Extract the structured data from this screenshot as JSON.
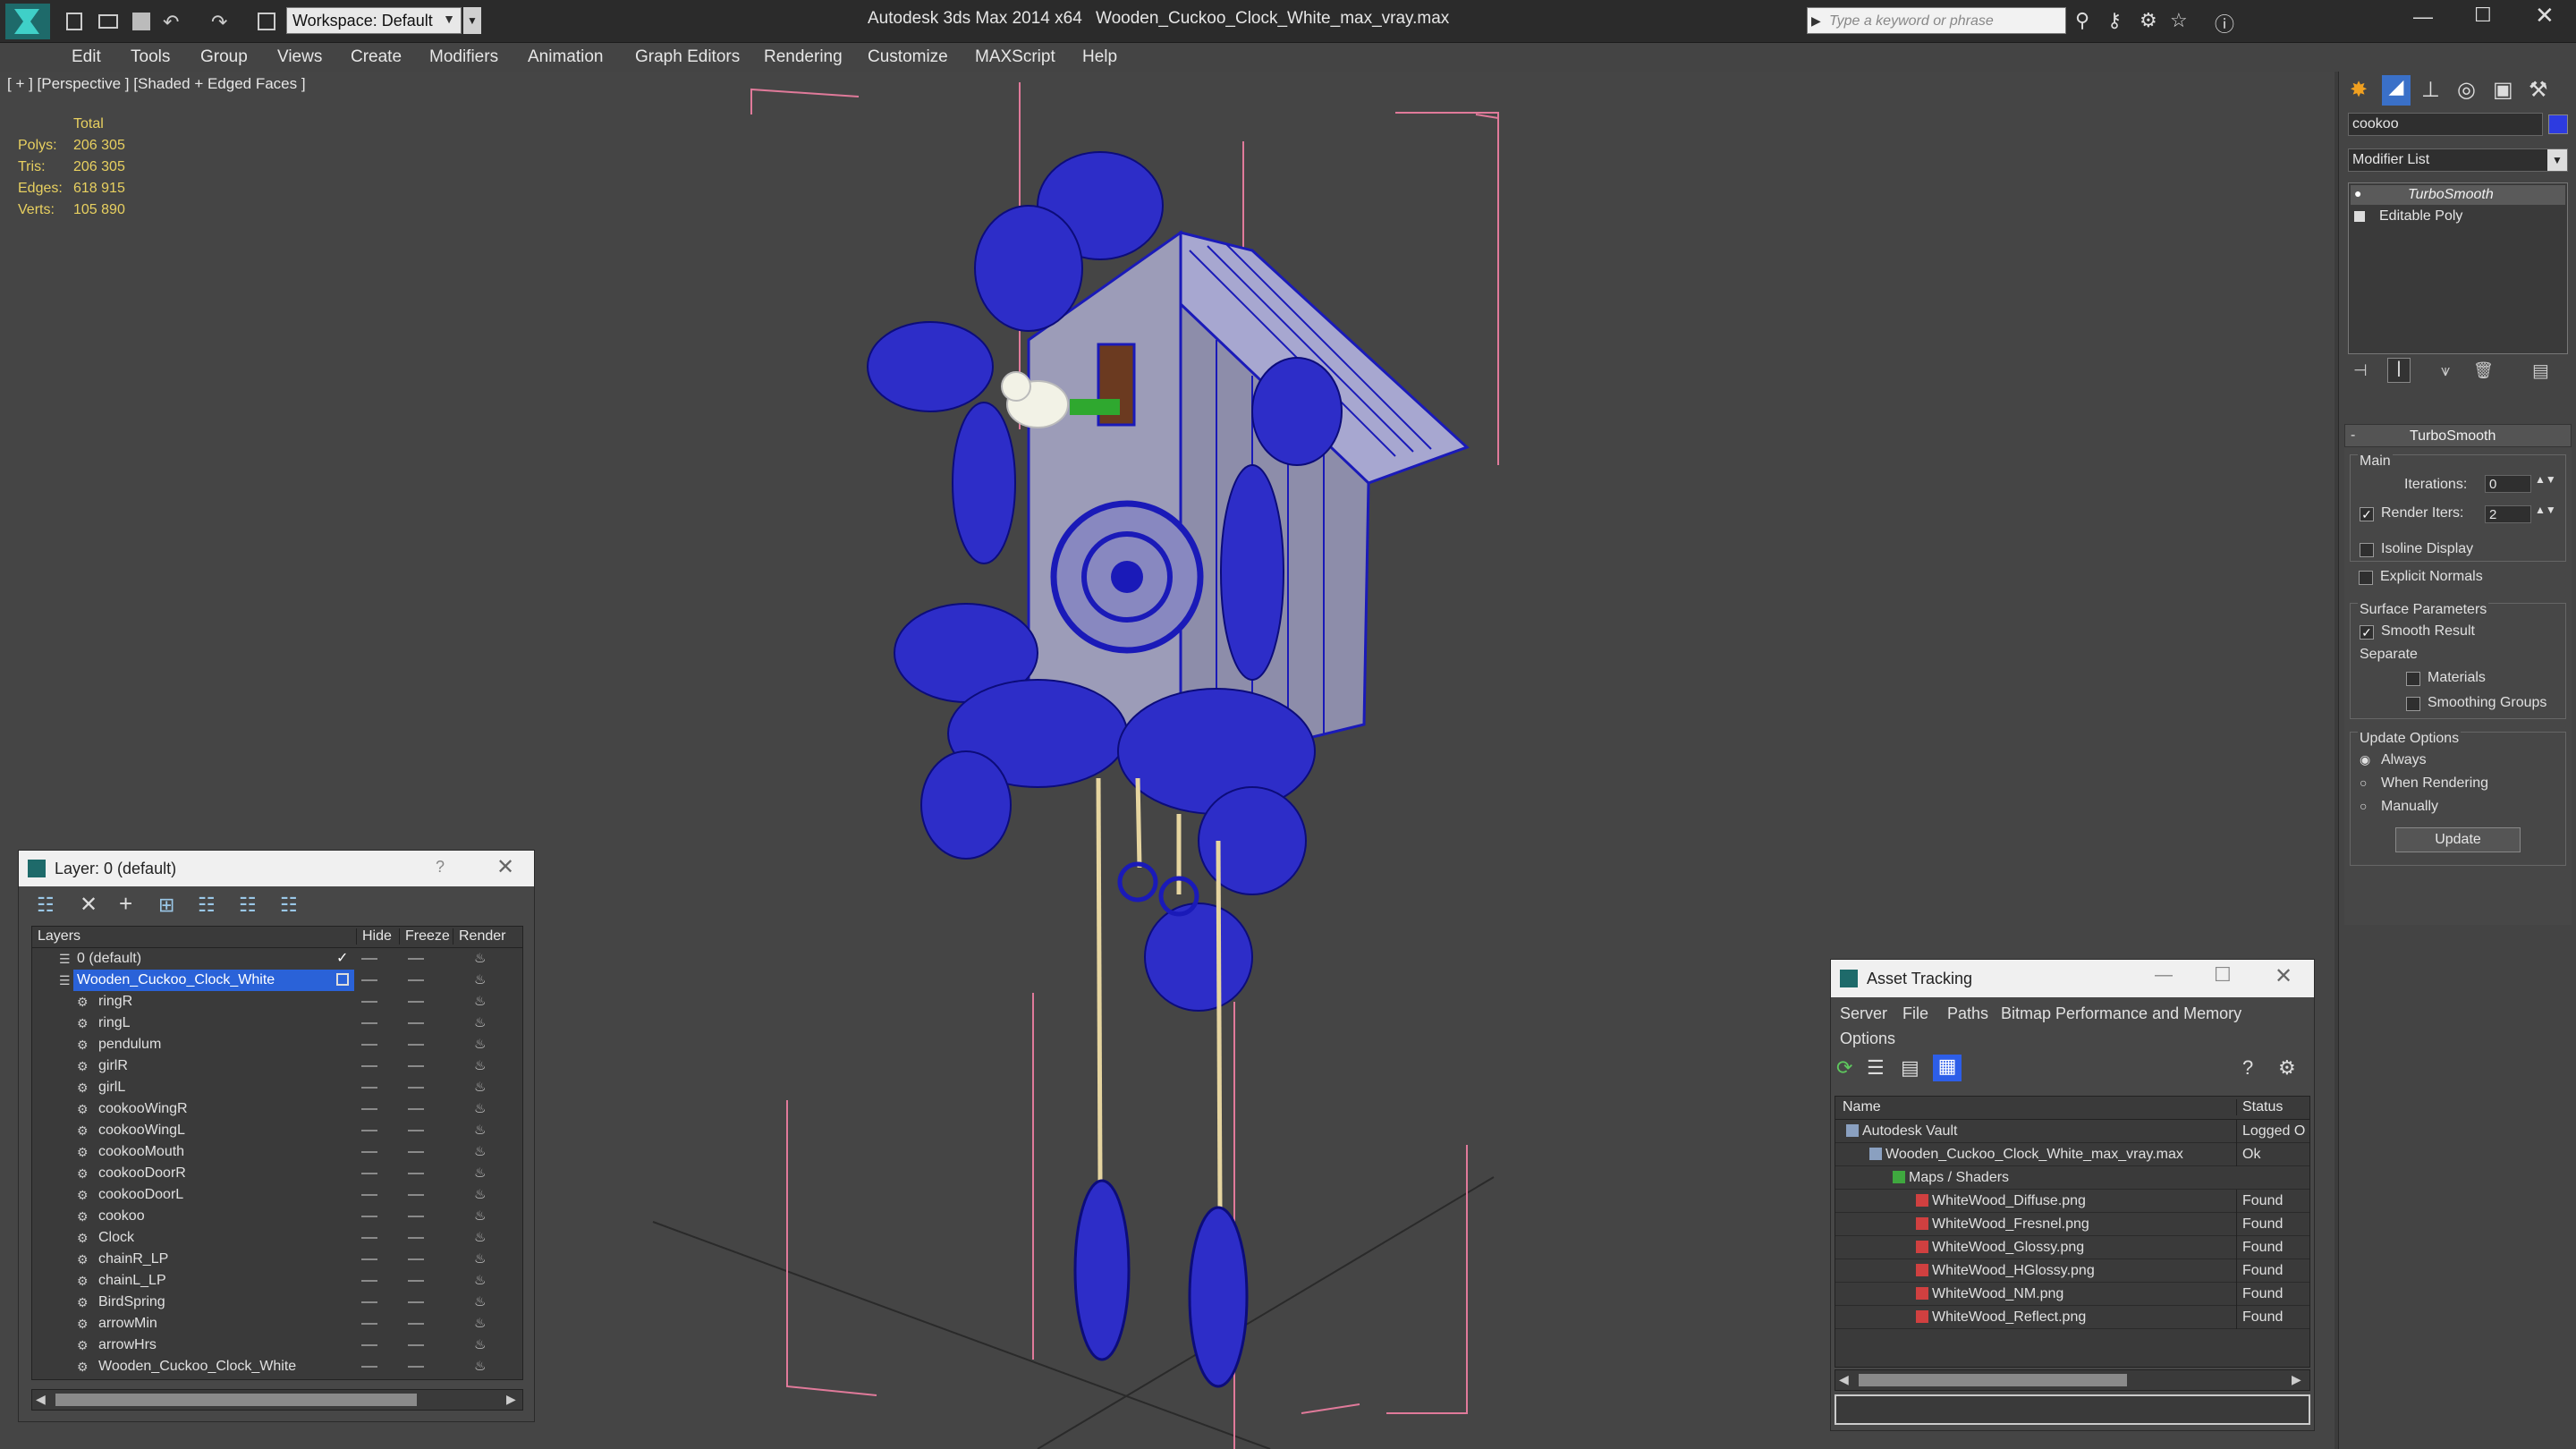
{
  "title_bar": {
    "workspace": "Workspace: Default",
    "app_title": "Autodesk 3ds Max  2014 x64",
    "file_title": "Wooden_Cuckoo_Clock_White_max_vray.max",
    "search_placeholder": "Type a keyword or phrase"
  },
  "menu": [
    "Edit",
    "Tools",
    "Group",
    "Views",
    "Create",
    "Modifiers",
    "Animation",
    "Graph Editors",
    "Rendering",
    "Customize",
    "MAXScript",
    "Help"
  ],
  "viewport": {
    "label": "[ + ] [Perspective ] [Shaded + Edged Faces ]",
    "stats_header": "Total",
    "stats": [
      {
        "k": "Polys:",
        "v": "206 305"
      },
      {
        "k": "Tris:",
        "v": "206 305"
      },
      {
        "k": "Edges:",
        "v": "618 915"
      },
      {
        "k": "Verts:",
        "v": "105 890"
      }
    ]
  },
  "layer_window": {
    "title": "Layer: 0 (default)",
    "help": "?",
    "columns": [
      "Layers",
      "Hide",
      "Freeze",
      "Render"
    ],
    "rows": [
      {
        "name": "0 (default)",
        "level": 0,
        "kind": "layer"
      },
      {
        "name": "Wooden_Cuckoo_Clock_White",
        "level": 0,
        "kind": "layer",
        "selected": true
      },
      {
        "name": "ringR",
        "level": 1,
        "kind": "obj"
      },
      {
        "name": "ringL",
        "level": 1,
        "kind": "obj"
      },
      {
        "name": "pendulum",
        "level": 1,
        "kind": "obj"
      },
      {
        "name": "girlR",
        "level": 1,
        "kind": "obj"
      },
      {
        "name": "girlL",
        "level": 1,
        "kind": "obj"
      },
      {
        "name": "cookooWingR",
        "level": 1,
        "kind": "obj"
      },
      {
        "name": "cookooWingL",
        "level": 1,
        "kind": "obj"
      },
      {
        "name": "cookooMouth",
        "level": 1,
        "kind": "obj"
      },
      {
        "name": "cookooDoorR",
        "level": 1,
        "kind": "obj"
      },
      {
        "name": "cookooDoorL",
        "level": 1,
        "kind": "obj"
      },
      {
        "name": "cookoo",
        "level": 1,
        "kind": "obj"
      },
      {
        "name": "Clock",
        "level": 1,
        "kind": "obj"
      },
      {
        "name": "chainR_LP",
        "level": 1,
        "kind": "obj"
      },
      {
        "name": "chainL_LP",
        "level": 1,
        "kind": "obj"
      },
      {
        "name": "BirdSpring",
        "level": 1,
        "kind": "obj"
      },
      {
        "name": "arrowMin",
        "level": 1,
        "kind": "obj"
      },
      {
        "name": "arrowHrs",
        "level": 1,
        "kind": "obj"
      },
      {
        "name": "Wooden_Cuckoo_Clock_White",
        "level": 1,
        "kind": "obj"
      }
    ]
  },
  "asset_window": {
    "title": "Asset Tracking",
    "menu": [
      "Server",
      "File",
      "Paths",
      "Bitmap Performance and Memory",
      "Options"
    ],
    "columns": [
      "Name",
      "Status"
    ],
    "rows": [
      {
        "name": "Autodesk Vault",
        "status": "Logged O",
        "level": 0
      },
      {
        "name": "Wooden_Cuckoo_Clock_White_max_vray.max",
        "status": "Ok",
        "level": 1
      },
      {
        "name": "Maps / Shaders",
        "status": "",
        "level": 2
      },
      {
        "name": "WhiteWood_Diffuse.png",
        "status": "Found",
        "level": 3
      },
      {
        "name": "WhiteWood_Fresnel.png",
        "status": "Found",
        "level": 3
      },
      {
        "name": "WhiteWood_Glossy.png",
        "status": "Found",
        "level": 3
      },
      {
        "name": "WhiteWood_HGlossy.png",
        "status": "Found",
        "level": 3
      },
      {
        "name": "WhiteWood_NM.png",
        "status": "Found",
        "level": 3
      },
      {
        "name": "WhiteWood_Reflect.png",
        "status": "Found",
        "level": 3
      }
    ]
  },
  "command_panel": {
    "object_name": "cookoo",
    "modifier_list": "Modifier List",
    "stack": [
      "TurboSmooth",
      "Editable Poly"
    ],
    "rollout_title": "TurboSmooth",
    "main_label": "Main",
    "iterations_label": "Iterations:",
    "iterations_value": "0",
    "render_iters_label": "Render Iters:",
    "render_iters_value": "2",
    "isoline": "Isoline Display",
    "explicit_normals": "Explicit Normals",
    "surface_params": "Surface Parameters",
    "smooth_result": "Smooth Result",
    "separate": "Separate",
    "materials": "Materials",
    "smoothing_groups": "Smoothing Groups",
    "update_options": "Update Options",
    "always": "Always",
    "when_rendering": "When Rendering",
    "manually": "Manually",
    "update_button": "Update"
  },
  "colors": {
    "accent": "#2d5ee8",
    "wire": "#1a1ab8",
    "selection": "#2a62d8"
  }
}
